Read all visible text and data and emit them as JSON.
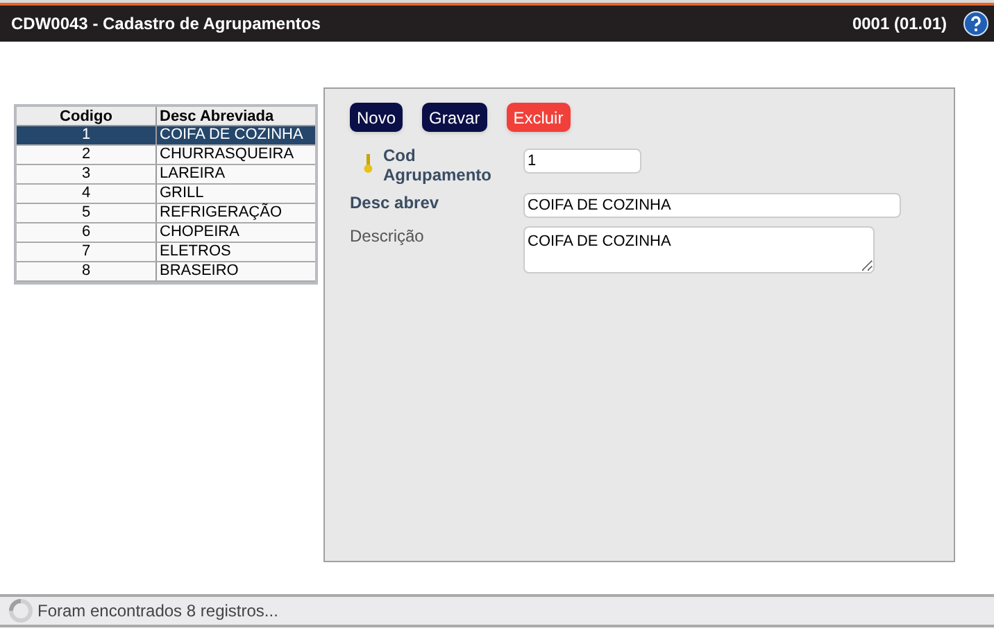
{
  "window": {
    "title": "CDW0043 - Cadastro de Agrupamentos",
    "version": "0001 (01.01)"
  },
  "table": {
    "columns": [
      "Codigo",
      "Desc Abreviada"
    ],
    "rows": [
      {
        "cells": [
          "1",
          "COIFA DE COZINHA"
        ],
        "selected": true
      },
      {
        "cells": [
          "2",
          "CHURRASQUEIRA"
        ],
        "selected": false
      },
      {
        "cells": [
          "3",
          "LAREIRA"
        ],
        "selected": false
      },
      {
        "cells": [
          "4",
          "GRILL"
        ],
        "selected": false
      },
      {
        "cells": [
          "5",
          "REFRIGERAÇÃO"
        ],
        "selected": false
      },
      {
        "cells": [
          "6",
          "CHOPEIRA"
        ],
        "selected": false
      },
      {
        "cells": [
          "7",
          "ELETROS"
        ],
        "selected": false
      },
      {
        "cells": [
          "8",
          "BRASEIRO"
        ],
        "selected": false
      }
    ]
  },
  "buttons": [
    {
      "label": "Novo",
      "kind": "primary"
    },
    {
      "label": "Gravar",
      "kind": "primary"
    },
    {
      "label": "Excluir",
      "kind": "danger"
    }
  ],
  "fields": [
    {
      "label": "Cod Agrupamento",
      "kind": "key",
      "value": "1"
    },
    {
      "label": "Desc abrev",
      "kind": "text",
      "value": "COIFA DE COZINHA"
    },
    {
      "label": "Descrição",
      "kind": "textarea",
      "value": "COIFA DE COZINHA"
    }
  ],
  "status_bar": "Foram encontrados 8 registros..."
}
